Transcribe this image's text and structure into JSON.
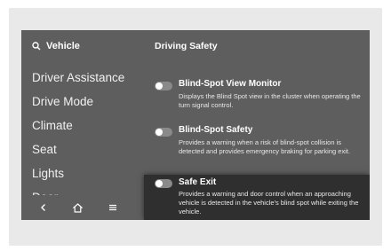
{
  "sidebar": {
    "search_label": "Vehicle",
    "items": [
      {
        "label": "Driver Assistance"
      },
      {
        "label": "Drive Mode"
      },
      {
        "label": "Climate"
      },
      {
        "label": "Seat"
      },
      {
        "label": "Lights"
      },
      {
        "label": "Door"
      }
    ],
    "bottom_icons": [
      "back-icon",
      "home-icon",
      "menu-icon"
    ]
  },
  "content": {
    "section_title": "Driving Safety",
    "options": [
      {
        "title": "Blind-Spot View Monitor",
        "description": "Displays the Blind Spot view in the cluster when operating the turn signal control.",
        "enabled": false
      },
      {
        "title": "Blind-Spot Safety",
        "description": "Provides a warning when a risk of blind-spot collision is detected and provides emergency braking for parking exit.",
        "enabled": false
      },
      {
        "title": "Safe Exit",
        "description": "Provides a warning and door control when an approaching vehicle is detected in the vehicle's blind spot while exiting the vehicle.",
        "enabled": false,
        "highlighted": true
      }
    ]
  },
  "colors": {
    "screen_bg": "#5e5e5e",
    "highlight_bg": "#2f2f2f",
    "frame_bg": "#e9e9e9"
  }
}
